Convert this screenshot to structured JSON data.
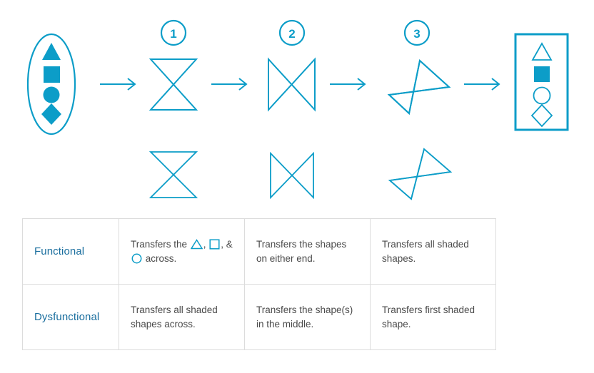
{
  "theme": {
    "accent": "#0c9dc8",
    "accent_dark": "#1a6e9e",
    "text": "#4a4a4a",
    "border": "#dcdcdc",
    "background": "#ffffff"
  },
  "diagram": {
    "source_group": {
      "name": "input-shape-set",
      "shapes": [
        {
          "glyph": "triangle",
          "fill": "solid"
        },
        {
          "glyph": "square",
          "fill": "solid"
        },
        {
          "glyph": "circle",
          "fill": "solid"
        },
        {
          "glyph": "diamond",
          "fill": "solid"
        }
      ]
    },
    "steps": [
      {
        "number": "1",
        "shape": "vertical-hourglass"
      },
      {
        "number": "2",
        "shape": "horizontal-bowtie"
      },
      {
        "number": "3",
        "shape": "rotated-pinwheel-bowtie"
      }
    ],
    "repeat_row_shapes": [
      "vertical-hourglass",
      "horizontal-bowtie",
      "rotated-pinwheel-bowtie"
    ],
    "arrow_count": 4,
    "arrow_glyph": "right-arrow",
    "outcome_group": {
      "name": "output-shape-set",
      "shapes": [
        {
          "glyph": "triangle",
          "fill": "outline"
        },
        {
          "glyph": "square",
          "fill": "solid"
        },
        {
          "glyph": "circle",
          "fill": "outline"
        },
        {
          "glyph": "diamond",
          "fill": "outline"
        }
      ]
    }
  },
  "matrix": {
    "rows": [
      {
        "label": "Functional",
        "cells": [
          {
            "segments": [
              {
                "type": "text",
                "value": "Transfers the "
              },
              {
                "type": "shape",
                "value": "triangle"
              },
              {
                "type": "text",
                "value": ", "
              },
              {
                "type": "shape",
                "value": "square"
              },
              {
                "type": "text",
                "value": ", & "
              },
              {
                "type": "shape",
                "value": "circle"
              },
              {
                "type": "text",
                "value": " across."
              }
            ],
            "plain": "Transfers the △, □, & ○ across."
          },
          {
            "plain": "Transfers the shapes on either end."
          },
          {
            "plain": "Transfers all shaded shapes."
          }
        ]
      },
      {
        "label": "Dysfunctional",
        "cells": [
          {
            "plain": "Transfers all shaded shapes across."
          },
          {
            "plain": "Transfers the shape(s) in the middle."
          },
          {
            "plain": "Transfers first shaded shape."
          }
        ]
      }
    ]
  }
}
